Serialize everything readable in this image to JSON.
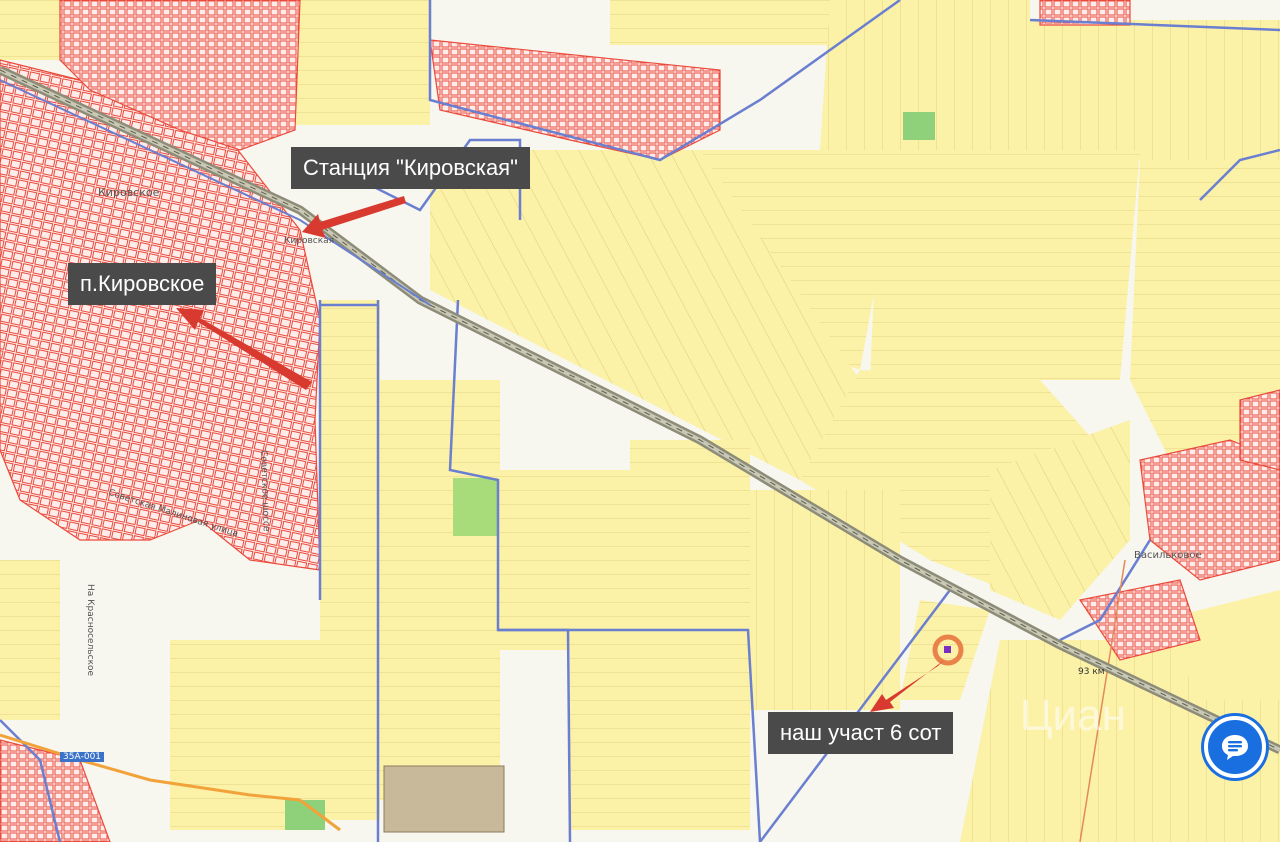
{
  "callouts": {
    "station": "Станция \"Кировская\"",
    "village": "п.Кировское",
    "plot": "наш участ 6 сот"
  },
  "map_labels": {
    "kirovskoe": "Кировское",
    "station_small": "Кировская",
    "vasilkovoe": "Васильковое",
    "road_sovetskoe": "Советское шоссе",
    "road_krasnoselskoe": "На Красносельское",
    "road_code": "35А-001",
    "km_mark": "93 км",
    "road_diagonal": "Советская Малиновая улица"
  },
  "watermark": "Циан",
  "icons": {
    "chat": "chat-icon"
  },
  "colors": {
    "field_yellow": "#fbf2a8",
    "field_border": "#e6d68a",
    "urban_red": "#ea4b3c",
    "boundary_blue": "#6a7fd0",
    "railway": "#9a9a88",
    "callout_bg": "#4a4a4a",
    "arrow_red": "#d83a30",
    "chat_blue": "#1a6fe0"
  }
}
